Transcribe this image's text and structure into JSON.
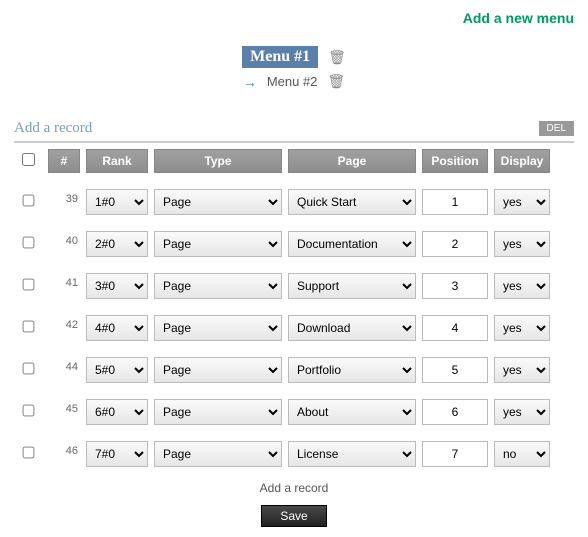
{
  "topLink": "Add a new menu",
  "menus": {
    "active": "Menu #1",
    "inactive": "Menu #2"
  },
  "section": {
    "title": "Add a record",
    "delLabel": "DEL"
  },
  "headers": {
    "num": "#",
    "rank": "Rank",
    "type": "Type",
    "page": "Page",
    "position": "Position",
    "display": "Display"
  },
  "rows": [
    {
      "id": "39",
      "rank": "1#0",
      "type": "Page",
      "page": "Quick Start",
      "position": "1",
      "display": "yes"
    },
    {
      "id": "40",
      "rank": "2#0",
      "type": "Page",
      "page": "Documentation",
      "position": "2",
      "display": "yes"
    },
    {
      "id": "41",
      "rank": "3#0",
      "type": "Page",
      "page": "Support",
      "position": "3",
      "display": "yes"
    },
    {
      "id": "42",
      "rank": "4#0",
      "type": "Page",
      "page": "Download",
      "position": "4",
      "display": "yes"
    },
    {
      "id": "44",
      "rank": "5#0",
      "type": "Page",
      "page": "Portfolio",
      "position": "5",
      "display": "yes"
    },
    {
      "id": "45",
      "rank": "6#0",
      "type": "Page",
      "page": "About",
      "position": "6",
      "display": "yes"
    },
    {
      "id": "46",
      "rank": "7#0",
      "type": "Page",
      "page": "License",
      "position": "7",
      "display": "no"
    }
  ],
  "footerAdd": "Add a record",
  "saveLabel": "Save"
}
